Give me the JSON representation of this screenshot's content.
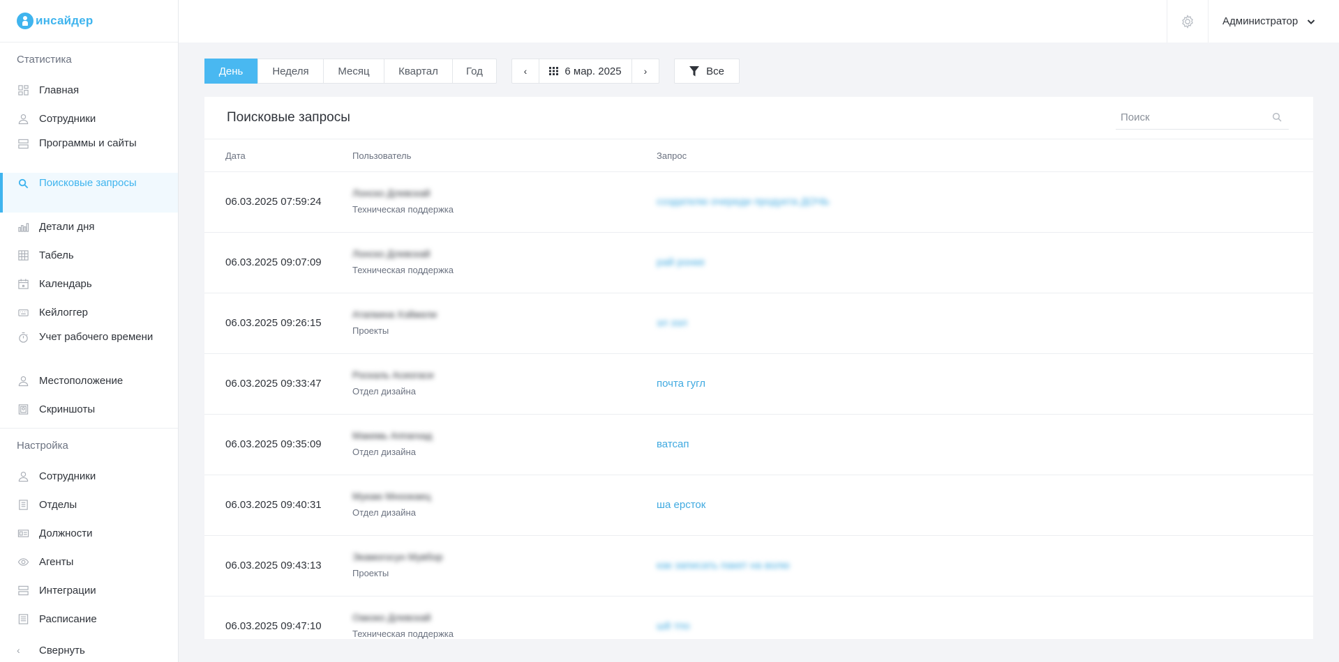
{
  "brand": {
    "name": "инсайдер"
  },
  "sidebar": {
    "stats_title": "Статистика",
    "stats_items": [
      {
        "label": "Главная",
        "icon": "dashboard-icon"
      },
      {
        "label": "Сотрудники",
        "icon": "user-icon"
      },
      {
        "label": "Программы и сайты",
        "icon": "apps-icon"
      },
      {
        "label": "Поисковые запросы",
        "icon": "search-icon",
        "active": true
      },
      {
        "label": "Детали дня",
        "icon": "bar-chart-icon"
      },
      {
        "label": "Табель",
        "icon": "table-icon"
      },
      {
        "label": "Календарь",
        "icon": "calendar-icon"
      },
      {
        "label": "Кейлоггер",
        "icon": "keyboard-icon"
      },
      {
        "label": "Учет рабочего времени",
        "icon": "timer-icon"
      },
      {
        "label": "Местоположение",
        "icon": "location-icon"
      },
      {
        "label": "Скриншоты",
        "icon": "screenshot-icon"
      }
    ],
    "settings_title": "Настройка",
    "settings_items": [
      {
        "label": "Сотрудники",
        "icon": "user-icon"
      },
      {
        "label": "Отделы",
        "icon": "departments-icon"
      },
      {
        "label": "Должности",
        "icon": "id-card-icon"
      },
      {
        "label": "Агенты",
        "icon": "eye-icon"
      },
      {
        "label": "Интеграции",
        "icon": "integrations-icon"
      },
      {
        "label": "Расписание",
        "icon": "schedule-icon"
      }
    ],
    "collapse_label": "Свернуть"
  },
  "header": {
    "user": "Администратор"
  },
  "toolbar": {
    "periods": [
      "День",
      "Неделя",
      "Месяц",
      "Квартал",
      "Год"
    ],
    "active_period": "День",
    "date": "6 мар. 2025",
    "filter": "Все"
  },
  "card": {
    "title": "Поисковые запросы",
    "search_placeholder": "Поиск",
    "columns": {
      "date": "Дата",
      "user": "Пользователь",
      "query": "Запрос"
    },
    "rows": [
      {
        "date": "06.03.2025 07:59:24",
        "user": "Лонско Длевскай",
        "dept": "Техническая поддержка",
        "query": "создателю очереди продукта ДОЧЬ",
        "query_blurred": true
      },
      {
        "date": "06.03.2025 09:07:09",
        "user": "Лонско Длевскай",
        "dept": "Техническая поддержка",
        "query": "рай ронке",
        "query_blurred": true
      },
      {
        "date": "06.03.2025 09:26:15",
        "user": "Атапкина Хэйжели",
        "dept": "Проекты",
        "query": "эл ээл",
        "query_blurred": true
      },
      {
        "date": "06.03.2025 09:33:47",
        "user": "Роскаль Асиогаси",
        "dept": "Отдел дизайна",
        "query": "почта гугл",
        "query_blurred": false
      },
      {
        "date": "06.03.2025 09:35:09",
        "user": "Макемь Аппагкад",
        "dept": "Отдел дизайна",
        "query": "ватсап",
        "query_blurred": false
      },
      {
        "date": "06.03.2025 09:40:31",
        "user": "Мукаю Мноокаец",
        "dept": "Отдел дизайна",
        "query": "ша ерсток",
        "query_blurred": false
      },
      {
        "date": "06.03.2025 09:43:13",
        "user": "Экамогосун Мувбор",
        "dept": "Проекты",
        "query": "как записать пакет на волю",
        "query_blurred": true
      },
      {
        "date": "06.03.2025 09:47:10",
        "user": "Оакоко Длевскай",
        "dept": "Техническая поддержка",
        "query": "ш8 тпо",
        "query_blurred": true
      }
    ]
  },
  "colors": {
    "accent": "#3fb4ee",
    "active_bg": "#f1f9fe",
    "link": "#3fa9e0",
    "background": "#f3f4f7"
  }
}
